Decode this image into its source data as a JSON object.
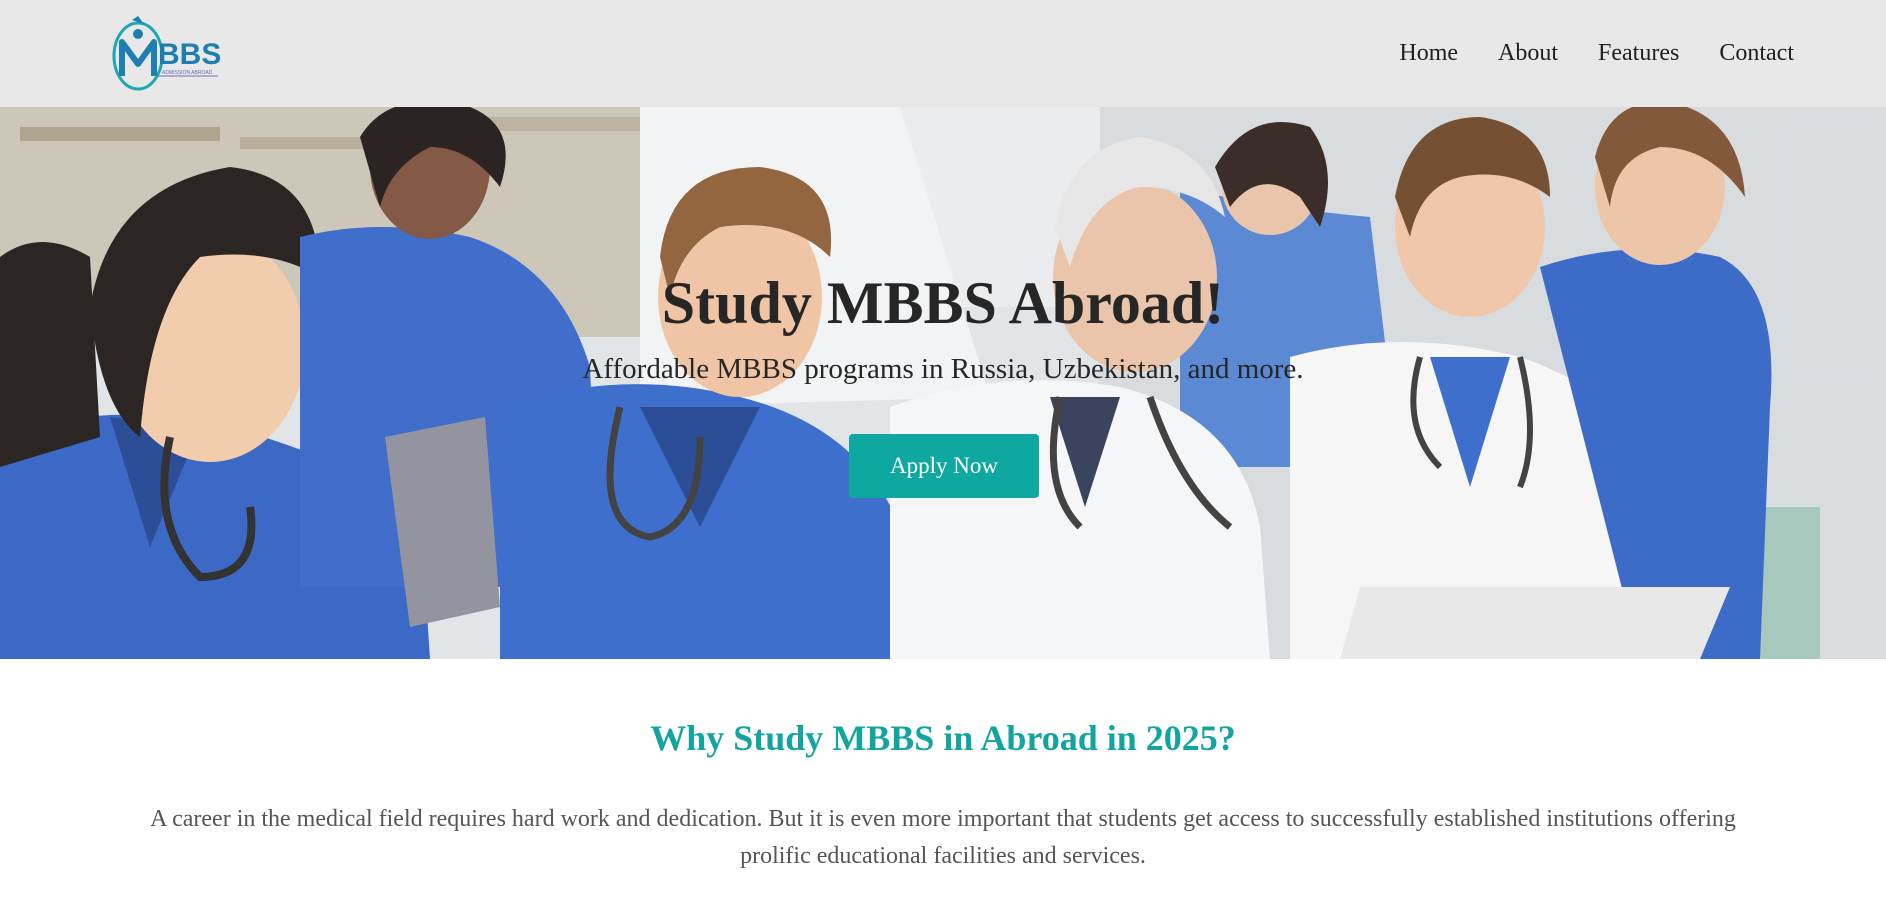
{
  "header": {
    "logo": {
      "text": "BBS",
      "tagline": "ADMISSION ABROAD",
      "icon": "caduceus-plane-logo"
    },
    "nav": [
      {
        "label": "Home"
      },
      {
        "label": "About"
      },
      {
        "label": "Features"
      },
      {
        "label": "Contact"
      }
    ]
  },
  "hero": {
    "title": "Study MBBS Abroad!",
    "subtitle": "Affordable MBBS programs in Russia, Uzbekistan, and more.",
    "cta_label": "Apply Now",
    "image": "medical-students-group-photo"
  },
  "why": {
    "title": "Why Study MBBS in Abroad in 2025?",
    "text": "A career in the medical field requires hard work and dedication. But it is even more important that students get access to successfully established institutions offering prolific educational facilities and services."
  },
  "colors": {
    "accent": "#0fa8a0",
    "header_bg": "#e8e8e8",
    "scrub_blue": "#2d5fc4",
    "coat_white": "#f4f4f4"
  }
}
